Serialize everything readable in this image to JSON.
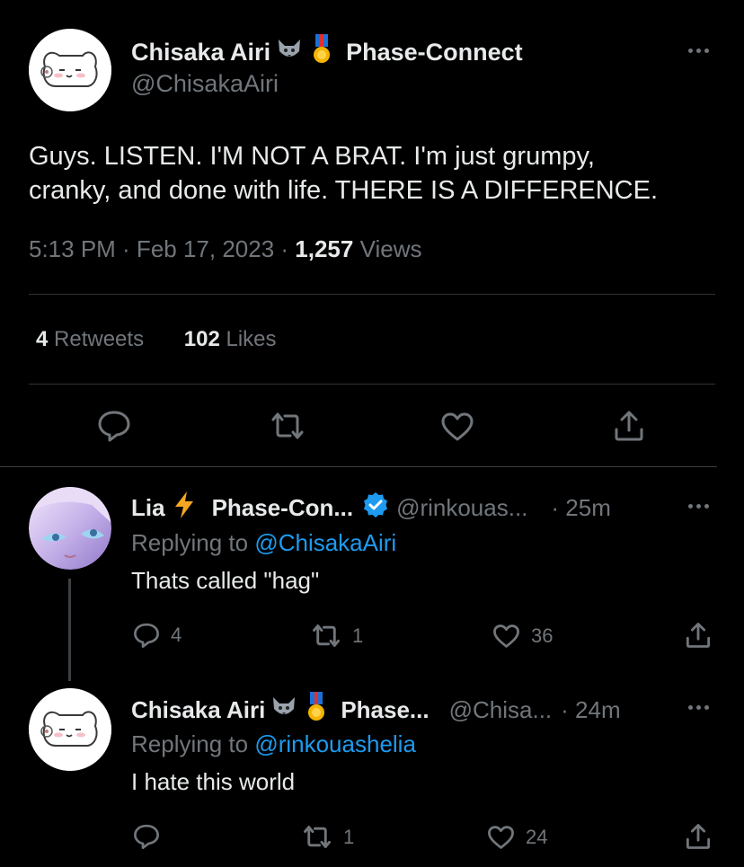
{
  "main_tweet": {
    "display_name": "Chisaka Airi",
    "affiliation": "Phase-Connect",
    "handle": "@ChisakaAiri",
    "text_line1": "Guys. LISTEN. I'M NOT A BRAT. I'm just grumpy,",
    "text_line2": "cranky, and done with life. THERE IS A DIFFERENCE.",
    "time_date": "5:13 PM · Feb 17, 2023 · ",
    "views_count": "1,257",
    "views_label": " Views",
    "retweets_count": "4",
    "retweets_label": " Retweets",
    "likes_count": "102",
    "likes_label": " Likes"
  },
  "reply1": {
    "display_name": "Lia",
    "affiliation": "Phase-Con...",
    "handle": "@rinkouas...",
    "time": "· 25m",
    "replying_prefix": "Replying to ",
    "replying_to": "@ChisakaAiri",
    "text": "Thats called \"hag\"",
    "reply_count": "4",
    "retweet_count": "1",
    "like_count": "36"
  },
  "reply2": {
    "display_name": "Chisaka Airi",
    "affiliation": "Phase...",
    "handle": "@Chisa...",
    "time": "· 24m",
    "replying_prefix": "Replying to ",
    "replying_to": "@rinkouashelia",
    "text": "I hate this world",
    "retweet_count": "1",
    "like_count": "24"
  },
  "colors": {
    "background": "#000000",
    "primary_text": "#e7e9ea",
    "secondary_text": "#71767b",
    "link": "#1d9bf0",
    "divider": "#2f3336"
  },
  "icons": [
    "more-icon",
    "reply-icon",
    "retweet-icon",
    "like-icon",
    "share-icon",
    "verified-icon",
    "lightning-icon",
    "wolf-icon",
    "medal-icon"
  ]
}
